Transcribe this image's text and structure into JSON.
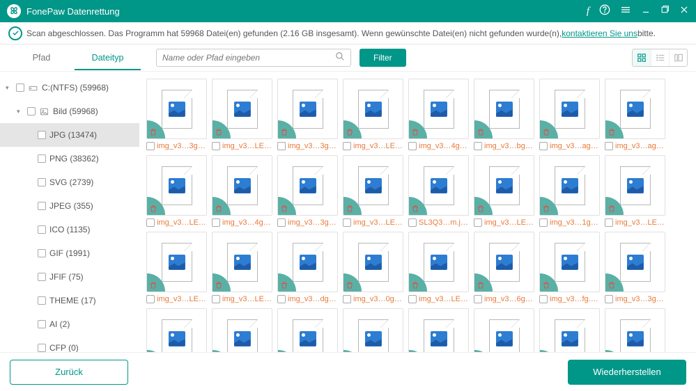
{
  "app": {
    "title": "FonePaw Datenrettung"
  },
  "status": {
    "text_before_link": "Scan abgeschlossen. Das Programm hat 59968 Datei(en) gefunden (2.16 GB insgesamt). Wenn gewünschte Datei(en) nicht gefunden wurde(n), ",
    "link": "kontaktieren Sie uns",
    "text_after_link": " bitte."
  },
  "tabs": {
    "path": "Pfad",
    "type": "Dateityp",
    "active": "type"
  },
  "search": {
    "placeholder": "Name oder Pfad eingeben"
  },
  "filter_label": "Filter",
  "tree": {
    "root": {
      "label": "C:(NTFS) (59968)"
    },
    "bild": {
      "label": "Bild (59968)"
    },
    "types": [
      "JPG (13474)",
      "PNG (38362)",
      "SVG (2739)",
      "JPEG (355)",
      "ICO (1135)",
      "GIF (1991)",
      "JFIF (75)",
      "THEME (17)",
      "AI (2)",
      "CFP (0)"
    ]
  },
  "files": [
    "img_v3…3g.jpg",
    "img_v3…LE.jpg",
    "img_v3…3g.jpg",
    "img_v3…LE.jpg",
    "img_v3…4g.jpg",
    "img_v3…bg.jpg",
    "img_v3…ag.jpg",
    "img_v3…ag.jpg",
    "img_v3…LE.jpg",
    "img_v3…4g.jpg",
    "img_v3…3g.jpg",
    "img_v3…LE.jpg",
    "SL3Q3…m.jpg",
    "img_v3…LE.jpg",
    "img_v3…1g.jpg",
    "img_v3…LE.jpg",
    "img_v3…LE.jpg",
    "img_v3…LE.jpg",
    "img_v3…dg.jpg",
    "img_v3…0g.jpg",
    "img_v3…LE.jpg",
    "img_v3…6g.jpg",
    "img_v3…fg.jpg",
    "img_v3…3g.jpg",
    "",
    "",
    "",
    "",
    "",
    "",
    "",
    ""
  ],
  "footer": {
    "back": "Zurück",
    "recover": "Wiederherstellen"
  }
}
